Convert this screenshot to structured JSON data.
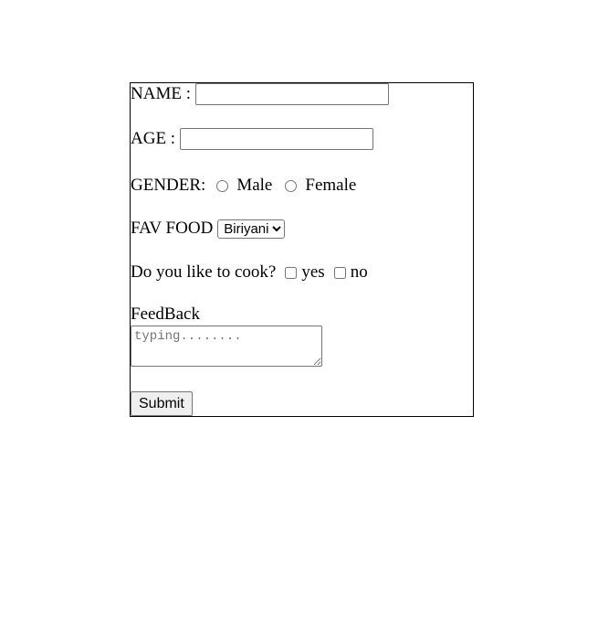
{
  "form": {
    "name": {
      "label": "NAME :",
      "value": ""
    },
    "age": {
      "label": "AGE :",
      "value": ""
    },
    "gender": {
      "label": "GENDER:",
      "options": [
        {
          "label": "Male",
          "checked": false
        },
        {
          "label": "Female",
          "checked": false
        }
      ]
    },
    "fav_food": {
      "label": "FAV FOOD",
      "selected": "Biriyani"
    },
    "cook": {
      "label": "Do you like to cook?",
      "options": [
        {
          "label": "yes",
          "checked": false
        },
        {
          "label": "no",
          "checked": false
        }
      ]
    },
    "feedback": {
      "label": "FeedBack",
      "placeholder": "typing........"
    },
    "submit_label": "Submit"
  },
  "colors": {
    "border": "#000000",
    "input_border": "#767676",
    "button_bg": "#efefef",
    "placeholder": "#757575"
  }
}
